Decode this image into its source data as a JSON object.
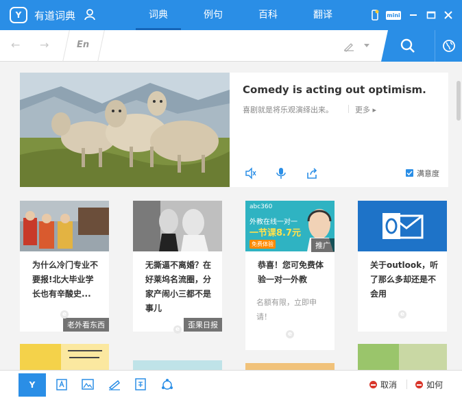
{
  "app": {
    "logo_text": "Y",
    "title": "有道词典"
  },
  "nav": {
    "tabs": [
      {
        "label": "词典"
      },
      {
        "label": "例句"
      },
      {
        "label": "百科"
      },
      {
        "label": "翻译"
      }
    ]
  },
  "window": {
    "mini_label": "mini"
  },
  "search": {
    "lang_label": "En",
    "value": "",
    "placeholder": ""
  },
  "featured": {
    "en": "Comedy is acting out optimism.",
    "zh": "喜剧就是将乐观演绎出来。",
    "more": "更多",
    "satisfaction": "满意度"
  },
  "cards": [
    {
      "tag": "老外看东西",
      "title": "为什么冷门专业不要报!北大毕业学长也有辛酸史...",
      "sub": ""
    },
    {
      "tag": "歪果日报",
      "title": "无撕逼不离婚？在好莱坞名流圈，分家产闹小三都不是事儿",
      "sub": ""
    },
    {
      "tag": "推广",
      "title": "恭喜！您可免费体验一对一外教",
      "sub": "名额有限，立即申请！",
      "ad_brand": "abc360",
      "ad_line1": "外教在线一对一",
      "ad_line2": "一节课8.7元",
      "ad_line3": "免费体验"
    },
    {
      "tag": "",
      "title": "关于outlook，听了那么多却还是不会用",
      "sub": ""
    }
  ],
  "card_icon_letter": "e",
  "bottom": {
    "logo_text": "Y",
    "cancel": "取消",
    "like": "如何"
  },
  "colors": {
    "accent": "#2a8ee6",
    "danger": "#d9362b"
  }
}
